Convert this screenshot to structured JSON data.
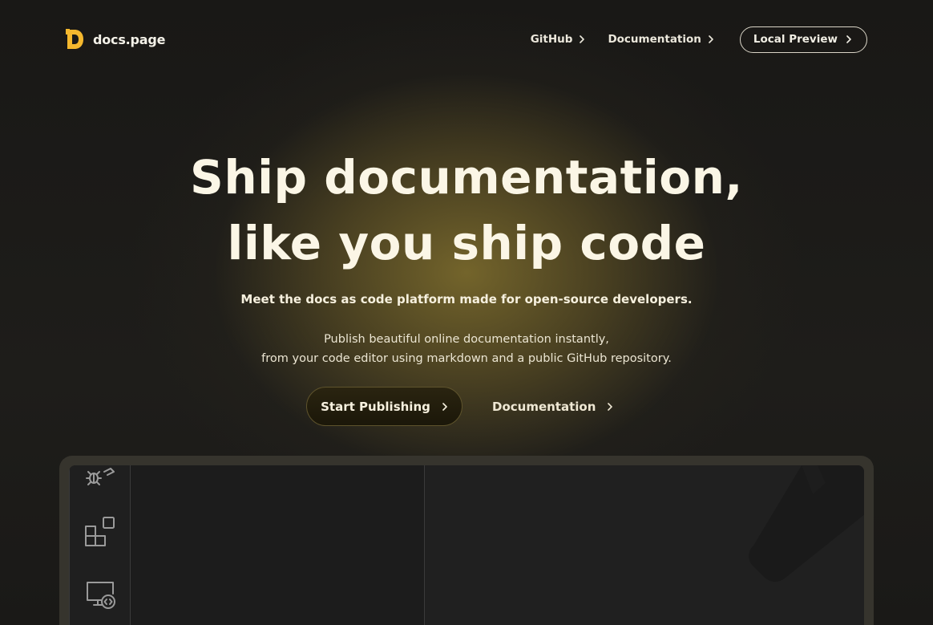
{
  "header": {
    "logo_text": "docs.page",
    "nav": [
      {
        "label": "GitHub"
      },
      {
        "label": "Documentation"
      }
    ],
    "preview_button": "Local Preview"
  },
  "hero": {
    "title_line1": "Ship documentation,",
    "title_line2": "like you ship code",
    "subtitle": "Meet the docs as code platform made for open-source developers.",
    "description_line1": "Publish beautiful online documentation instantly,",
    "description_line2": "from your code editor using markdown and a public GitHub repository.",
    "cta_primary": "Start Publishing",
    "cta_secondary": "Documentation"
  },
  "editor_preview": {
    "activity_icons": [
      "debug-icon",
      "extensions-icon",
      "remote-explorer-icon"
    ]
  },
  "colors": {
    "brand": "#f5b82e",
    "accent_glow": "#786c2c",
    "background": "#1b1a17",
    "text": "#fbf6e6"
  }
}
